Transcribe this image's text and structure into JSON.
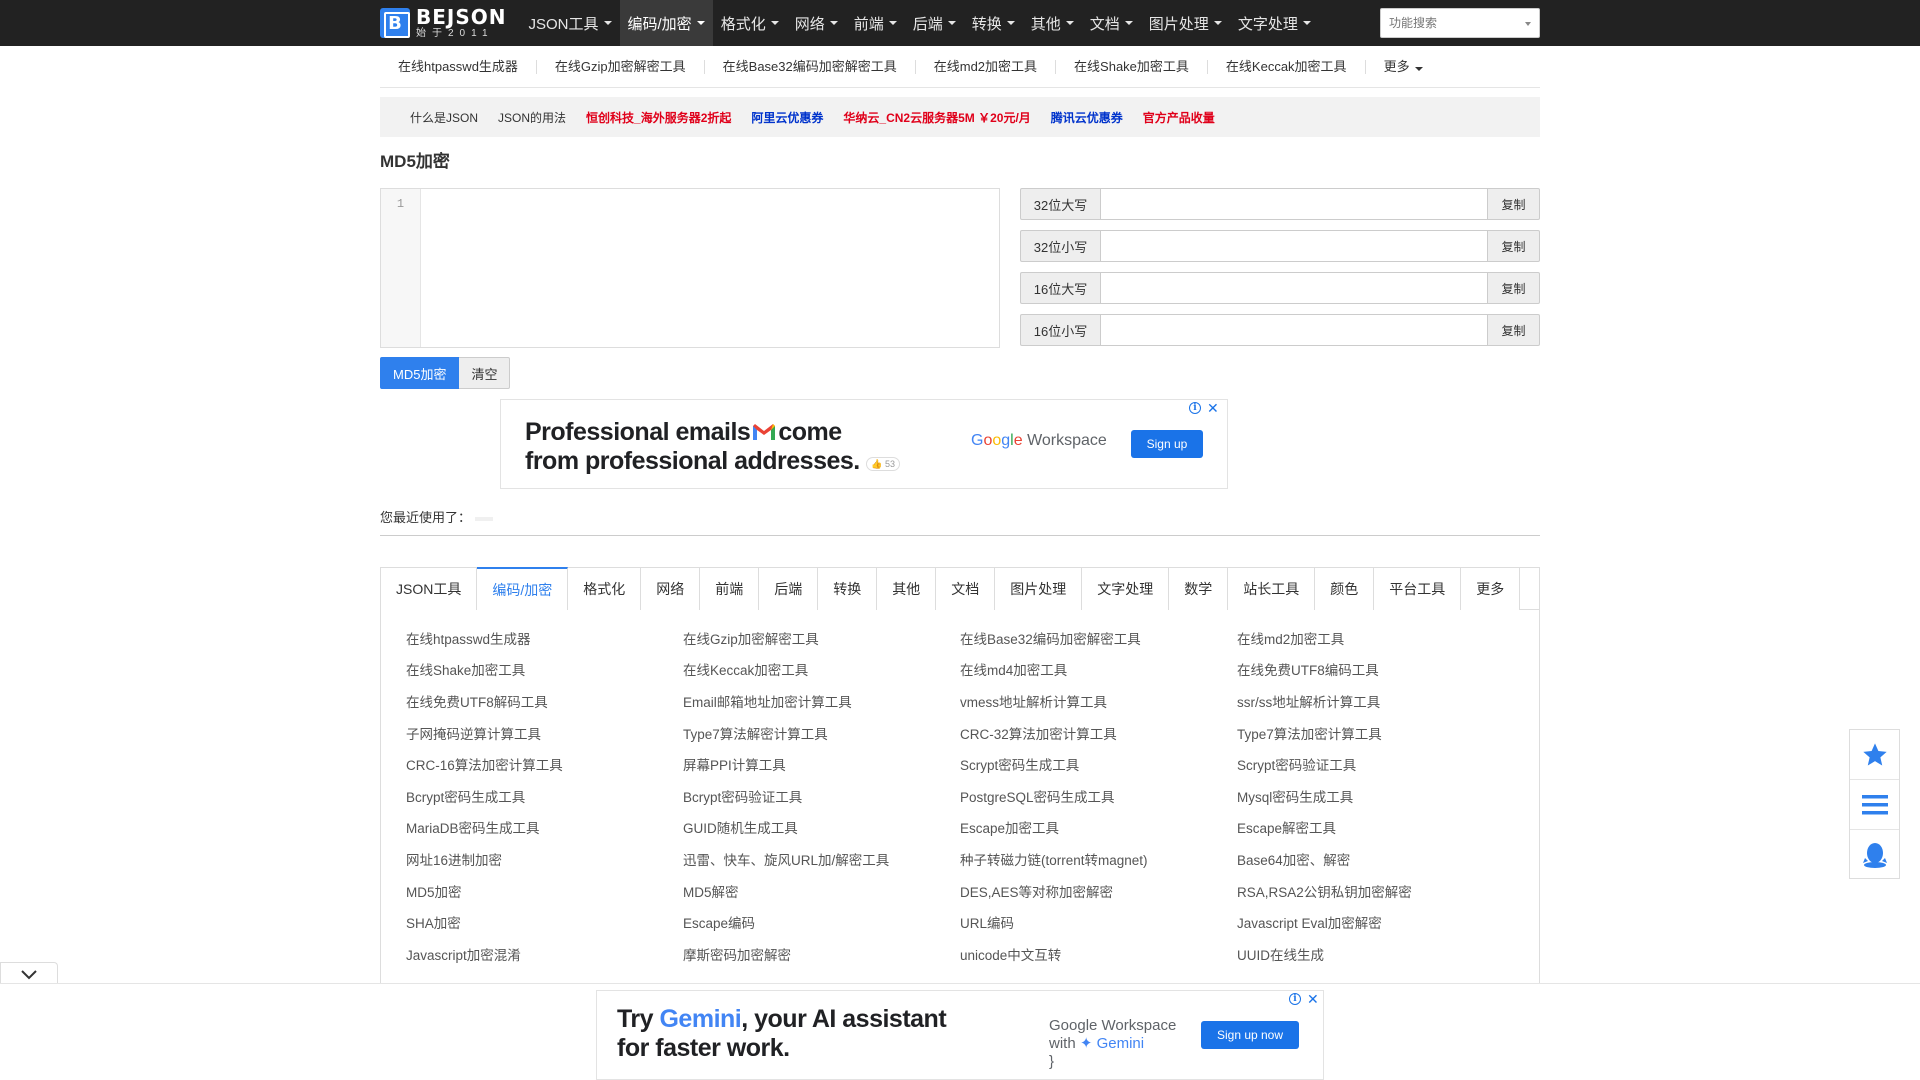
{
  "brand": {
    "name": "BEJSON",
    "sub": "始于2011",
    "logo_letter": "B",
    "color": "#2f80ed"
  },
  "topnav": {
    "items": [
      {
        "label": "JSON工具",
        "active": false
      },
      {
        "label": "编码/加密",
        "active": true
      },
      {
        "label": "格式化",
        "active": false
      },
      {
        "label": "网络",
        "active": false
      },
      {
        "label": "前端",
        "active": false
      },
      {
        "label": "后端",
        "active": false
      },
      {
        "label": "转换",
        "active": false
      },
      {
        "label": "其他",
        "active": false
      },
      {
        "label": "文档",
        "active": false
      },
      {
        "label": "图片处理",
        "active": false
      },
      {
        "label": "文字处理",
        "active": false
      }
    ],
    "search_placeholder": "功能搜索"
  },
  "subnav": {
    "items": [
      "在线htpasswd生成器",
      "在线Gzip加密解密工具",
      "在线Base32编码加密解密工具",
      "在线md2加密工具",
      "在线Shake加密工具",
      "在线Keccak加密工具"
    ],
    "more": "更多"
  },
  "notice": {
    "links": [
      {
        "text": "什么是JSON",
        "style": "plain"
      },
      {
        "text": "JSON的用法",
        "style": "plain"
      },
      {
        "text": "恒创科技_海外服务器2折起",
        "style": "red"
      },
      {
        "text": "阿里云优惠券",
        "style": "blue"
      },
      {
        "text": "华纳云_CN2云服务器5M ￥20元/月",
        "style": "red"
      },
      {
        "text": "腾讯云优惠券",
        "style": "blue"
      },
      {
        "text": "官方产品收量",
        "style": "red"
      }
    ]
  },
  "page_title": "MD5加密",
  "editor": {
    "line_number": "1",
    "value": ""
  },
  "results": {
    "rows": [
      {
        "label": "32位大写",
        "value": "",
        "button": "复制"
      },
      {
        "label": "32位小写",
        "value": "",
        "button": "复制"
      },
      {
        "label": "16位大写",
        "value": "",
        "button": "复制"
      },
      {
        "label": "16位小写",
        "value": "",
        "button": "复制"
      }
    ]
  },
  "actions": {
    "encrypt": "MD5加密",
    "clear": "清空"
  },
  "ad_top": {
    "headline_1": "Professional emails",
    "headline_1b": "come",
    "headline_2": "from professional addresses.",
    "like": "👍 53",
    "brand_google": "Google",
    "brand_product": "Workspace",
    "cta": "Sign up"
  },
  "recent": {
    "label": "您最近使用了："
  },
  "tabs": {
    "items": [
      {
        "label": "JSON工具",
        "active": false
      },
      {
        "label": "编码/加密",
        "active": true
      },
      {
        "label": "格式化",
        "active": false
      },
      {
        "label": "网络",
        "active": false
      },
      {
        "label": "前端",
        "active": false
      },
      {
        "label": "后端",
        "active": false
      },
      {
        "label": "转换",
        "active": false
      },
      {
        "label": "其他",
        "active": false
      },
      {
        "label": "文档",
        "active": false
      },
      {
        "label": "图片处理",
        "active": false
      },
      {
        "label": "文字处理",
        "active": false
      },
      {
        "label": "数学",
        "active": false
      },
      {
        "label": "站长工具",
        "active": false
      },
      {
        "label": "颜色",
        "active": false
      },
      {
        "label": "平台工具",
        "active": false
      },
      {
        "label": "更多",
        "active": false
      }
    ],
    "links": [
      "在线htpasswd生成器",
      "在线Gzip加密解密工具",
      "在线Base32编码加密解密工具",
      "在线md2加密工具",
      "在线Shake加密工具",
      "在线Keccak加密工具",
      "在线md4加密工具",
      "在线免费UTF8编码工具",
      "在线免费UTF8解码工具",
      "Email邮箱地址加密计算工具",
      "vmess地址解析计算工具",
      "ssr/ss地址解析计算工具",
      "子网掩码逆算计算工具",
      "Type7算法解密计算工具",
      "CRC-32算法加密计算工具",
      "Type7算法加密计算工具",
      "CRC-16算法加密计算工具",
      "屏幕PPI计算工具",
      "Scrypt密码生成工具",
      "Scrypt密码验证工具",
      "Bcrypt密码生成工具",
      "Bcrypt密码验证工具",
      "PostgreSQL密码生成工具",
      "Mysql密码生成工具",
      "MariaDB密码生成工具",
      "GUID随机生成工具",
      "Escape加密工具",
      "Escape解密工具",
      "网址16进制加密",
      "迅雷、快车、旋风URL加/解密工具",
      "种子转磁力链(torrent转magnet)",
      "Base64加密、解密",
      "MD5加密",
      "MD5解密",
      "DES,AES等对称加密解密",
      "RSA,RSA2公钥私钥加密解密",
      "SHA加密",
      "Escape编码",
      "URL编码",
      "Javascript Eval加密解密",
      "Javascript加密混淆",
      "摩斯密码加密解密",
      "unicode中文互转",
      "UUID在线生成"
    ]
  },
  "floatbar": {
    "icons": [
      "star-icon",
      "menu-icon",
      "qq-penguin-icon"
    ],
    "color": "#2f80ed"
  },
  "ad_bottom": {
    "headline_1a": "Try ",
    "headline_1b": "Gemini",
    "headline_1c": ", your AI assistant",
    "headline_2": "for faster work.",
    "brand_line_1": "Google Workspace",
    "brand_line_2a": "with ",
    "brand_line_2b": "Gemini",
    "cta": "Sign up now"
  }
}
